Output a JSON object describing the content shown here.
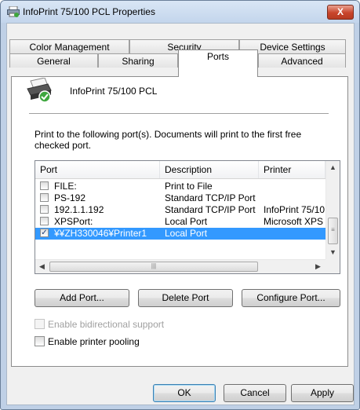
{
  "window": {
    "title": "InfoPrint 75/100 PCL Properties",
    "close_symbol": "X"
  },
  "tabs_row1": [
    "Color Management",
    "Security",
    "Device Settings"
  ],
  "tabs_row2": [
    "General",
    "Sharing",
    "Ports",
    "Advanced"
  ],
  "active_tab": "Ports",
  "printer": {
    "name": "InfoPrint 75/100 PCL",
    "icon": "printer-icon"
  },
  "instructions": "Print to the following port(s). Documents will print to the first free checked port.",
  "ports_list": {
    "columns": [
      "Port",
      "Description",
      "Printer"
    ],
    "rows": [
      {
        "checked": false,
        "port": "FILE:",
        "description": "Print to File",
        "printer": ""
      },
      {
        "checked": false,
        "port": "PS-192",
        "description": "Standard TCP/IP Port",
        "printer": ""
      },
      {
        "checked": false,
        "port": "192.1.1.192",
        "description": "Standard TCP/IP Port",
        "printer": "InfoPrint 75/10"
      },
      {
        "checked": false,
        "port": "XPSPort:",
        "description": "Local Port",
        "printer": "Microsoft XPS"
      },
      {
        "checked": true,
        "port": "¥¥ZH330046¥Printer1",
        "description": "Local Port",
        "printer": "",
        "selected": true
      }
    ]
  },
  "buttons": {
    "add_port": "Add Port...",
    "delete_port": "Delete Port",
    "configure_port": "Configure Port..."
  },
  "options": {
    "bidirectional": "Enable bidirectional support",
    "pooling": "Enable printer pooling"
  },
  "dialog_buttons": {
    "ok": "OK",
    "cancel": "Cancel",
    "apply": "Apply"
  },
  "colors": {
    "selection": "#3399ff",
    "titlebar": "#c3d5ec",
    "close": "#c8452b"
  }
}
